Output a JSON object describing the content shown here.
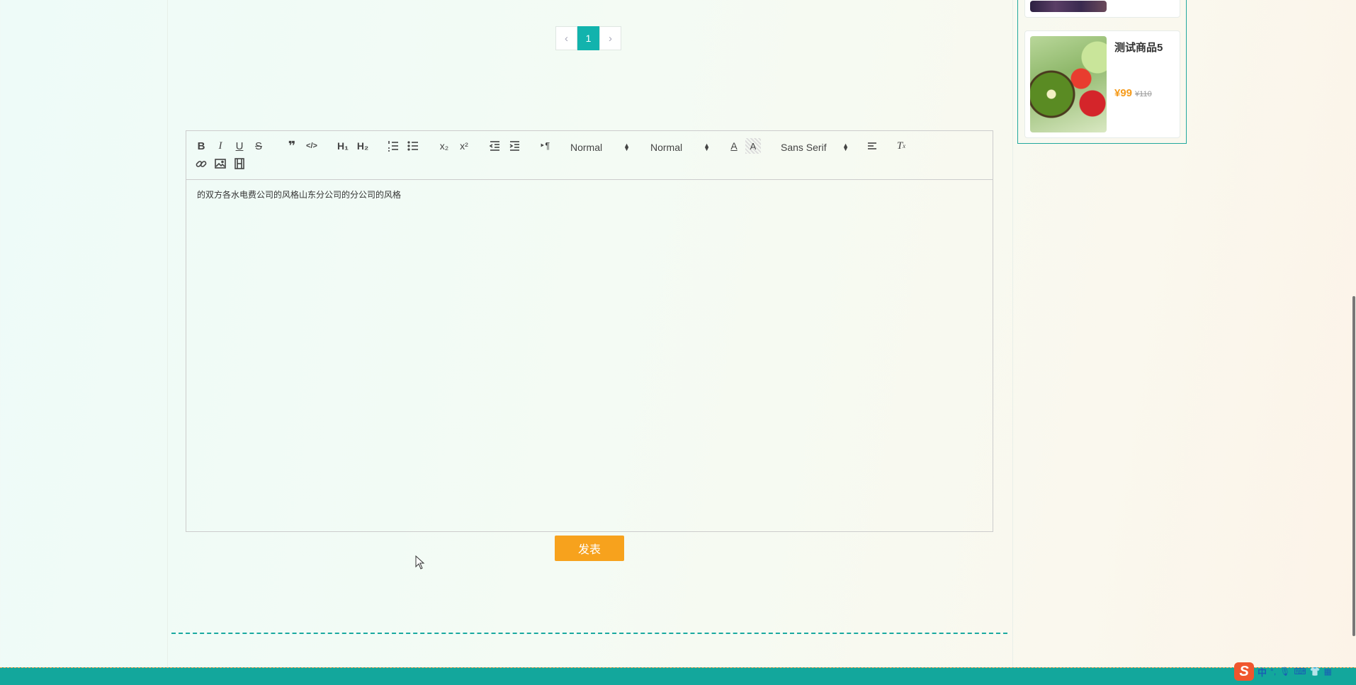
{
  "pagination": {
    "prev": "‹",
    "current": "1",
    "next": "›"
  },
  "editor": {
    "header_picker": "Normal",
    "size_picker": "Normal",
    "font_picker": "Sans Serif",
    "content": "的双方各水电费公司的风格山东分公司的分公司的风格"
  },
  "submit_label": "发表",
  "sidebar": {
    "products": [
      {
        "name": "测试商品5",
        "price": "¥99",
        "old_price": "¥110"
      }
    ]
  },
  "ime": {
    "logo": "S",
    "lang": "中",
    "punct": "°,"
  }
}
